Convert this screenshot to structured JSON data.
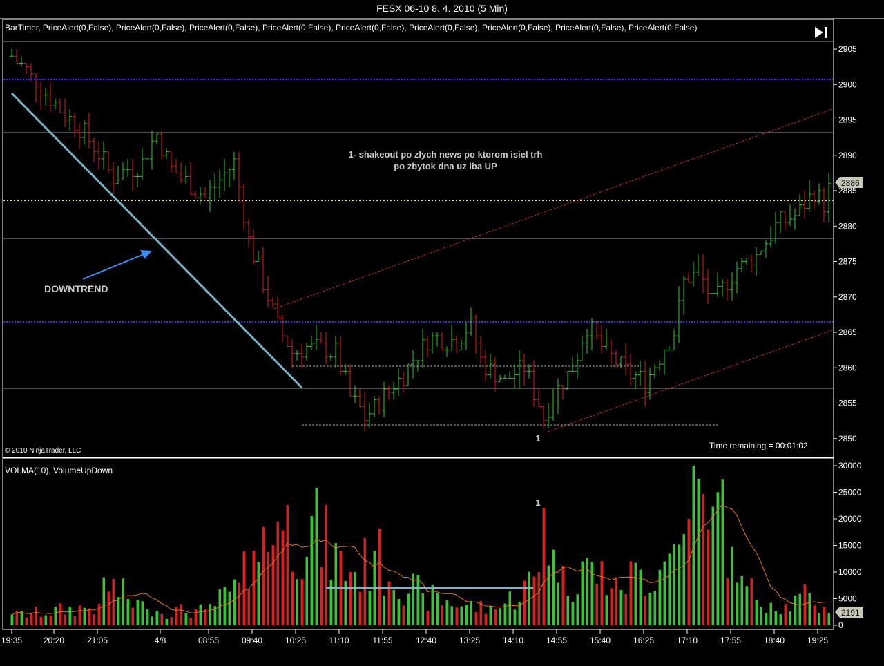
{
  "window": {
    "title": "FESX 06-10  8. 4. 2010 (5 Min)"
  },
  "price_panel": {
    "indicators_label": "BarTimer, PriceAlert(0,False), PriceAlert(0,False),  PriceAlert(0,False), PriceAlert(0,False), PriceAlert(0,False), PriceAlert(0,False),  PriceAlert(0,False), PriceAlert(0,False), PriceAlert(0,False)",
    "copyright": "© 2010 NinjaTrader, LLC",
    "time_remaining": "Time remaining = 00:01:02",
    "annotation_downtrend": "DOWNTREND",
    "annotation_note_line1": "1- shakeout po zlych news po ktorom isiel trh",
    "annotation_note_line2": "po zbytok dna uz iba UP",
    "marker_1": "1",
    "last_price": "2886",
    "axis_ticks": [
      "2905",
      "2900",
      "2895",
      "2890",
      "2885",
      "2880",
      "2875",
      "2870",
      "2865",
      "2860",
      "2855",
      "2850"
    ]
  },
  "volume_panel": {
    "indicators_label": "VOLMA(10), VolumeUpDown",
    "marker_1": "1",
    "last_volume": "2191",
    "axis_ticks": [
      "30000",
      "25000",
      "20000",
      "15000",
      "10000",
      "5000",
      "0"
    ]
  },
  "time_axis": [
    "19:35",
    "20:20",
    "21:05",
    "4/8",
    "08:55",
    "09:40",
    "10:25",
    "11:10",
    "11:55",
    "12:40",
    "13:25",
    "14:10",
    "14:55",
    "15:40",
    "16:25",
    "17:10",
    "17:55",
    "18:40",
    "19:25"
  ],
  "colors": {
    "up": "#32c832",
    "down": "#dc1e1e",
    "trend": "#78b4c8",
    "channel": "#c83232",
    "pivot": "#3232ff",
    "volma": "#e07820"
  },
  "chart_data": {
    "type": "bar",
    "title": "FESX 06-10 5 Min",
    "ylim": [
      2848,
      2908
    ],
    "volume_ylim": [
      0,
      30000
    ],
    "bar_count": 170,
    "close_anchors": [
      [
        0,
        2904
      ],
      [
        15,
        2893
      ],
      [
        21,
        2887
      ],
      [
        27,
        2889
      ],
      [
        30,
        2893
      ],
      [
        33,
        2888
      ],
      [
        40,
        2884
      ],
      [
        46,
        2889
      ],
      [
        49,
        2878
      ],
      [
        52,
        2872
      ],
      [
        55,
        2866
      ],
      [
        58,
        2862
      ],
      [
        62,
        2863
      ],
      [
        67,
        2862
      ],
      [
        70,
        2856
      ],
      [
        73,
        2853
      ],
      [
        77,
        2856
      ],
      [
        82,
        2860
      ],
      [
        86,
        2864
      ],
      [
        92,
        2864
      ],
      [
        95,
        2866
      ],
      [
        97,
        2861
      ],
      [
        102,
        2858
      ],
      [
        106,
        2860
      ],
      [
        110,
        2853
      ],
      [
        113,
        2857
      ],
      [
        116,
        2860
      ],
      [
        119,
        2866
      ],
      [
        123,
        2862
      ],
      [
        128,
        2859
      ],
      [
        131,
        2858
      ],
      [
        135,
        2863
      ],
      [
        137,
        2865
      ],
      [
        139,
        2872
      ],
      [
        142,
        2874
      ],
      [
        145,
        2869
      ],
      [
        150,
        2874
      ],
      [
        154,
        2876
      ],
      [
        158,
        2880
      ],
      [
        163,
        2882
      ],
      [
        166,
        2885
      ],
      [
        168,
        2883
      ],
      [
        169,
        2886
      ]
    ],
    "volume_anchors": [
      [
        0,
        2000
      ],
      [
        18,
        4000
      ],
      [
        19,
        9000
      ],
      [
        28,
        3000
      ],
      [
        40,
        3000
      ],
      [
        47,
        8000
      ],
      [
        50,
        14000
      ],
      [
        55,
        19500
      ],
      [
        62,
        20500
      ],
      [
        70,
        10000
      ],
      [
        75,
        14000
      ],
      [
        85,
        6000
      ],
      [
        100,
        3000
      ],
      [
        109,
        10000
      ],
      [
        110,
        22000
      ],
      [
        113,
        8000
      ],
      [
        118,
        12000
      ],
      [
        125,
        9000
      ],
      [
        135,
        12000
      ],
      [
        140,
        20000
      ],
      [
        141,
        30000
      ],
      [
        144,
        18000
      ],
      [
        146,
        25000
      ],
      [
        150,
        8000
      ],
      [
        160,
        4000
      ],
      [
        165,
        6000
      ],
      [
        169,
        2191
      ]
    ],
    "volume_ma_last": 2800
  }
}
